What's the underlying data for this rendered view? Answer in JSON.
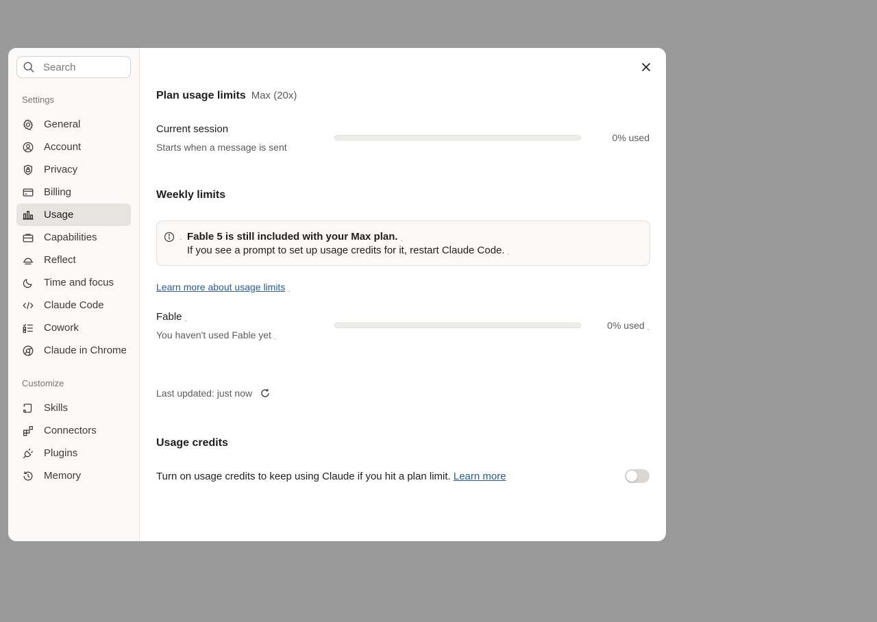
{
  "search": {
    "placeholder": "Search",
    "icon": "search-icon"
  },
  "sidebar": {
    "settings_label": "Settings",
    "settings_items": [
      {
        "label": "General",
        "icon": "gear-icon"
      },
      {
        "label": "Account",
        "icon": "user-circle-icon"
      },
      {
        "label": "Privacy",
        "icon": "shield-lock-icon"
      },
      {
        "label": "Billing",
        "icon": "credit-card-icon"
      },
      {
        "label": "Usage",
        "icon": "bar-chart-icon",
        "active": true
      },
      {
        "label": "Capabilities",
        "icon": "briefcase-icon"
      },
      {
        "label": "Reflect",
        "icon": "sunrise-icon"
      },
      {
        "label": "Time and focus",
        "icon": "moon-icon"
      },
      {
        "label": "Claude Code",
        "icon": "code-icon"
      },
      {
        "label": "Cowork",
        "icon": "checklist-icon"
      },
      {
        "label": "Claude in Chrome",
        "icon": "globe-icon"
      }
    ],
    "customize_label": "Customize",
    "customize_items": [
      {
        "label": "Skills",
        "icon": "scroll-icon"
      },
      {
        "label": "Connectors",
        "icon": "blocks-icon"
      },
      {
        "label": "Plugins",
        "icon": "plug-icon"
      },
      {
        "label": "Memory",
        "icon": "history-icon"
      }
    ]
  },
  "plan": {
    "title": "Plan usage limits",
    "plan_name": "Max (20x)",
    "session_label": "Current session",
    "session_sub": "Starts when a message is sent",
    "session_used_pct": 0,
    "session_used_text": "0% used"
  },
  "weekly": {
    "title": "Weekly limits",
    "notice_bold": "Fable 5 is still included with your Max plan.",
    "notice_text": "If you see a prompt to set up usage credits for it, restart Claude Code.",
    "learn_link": "Learn more about usage limits",
    "model_label": "Fable",
    "model_sub": "You haven't used Fable yet",
    "model_used_pct": 0,
    "model_used_text": "0% used"
  },
  "updated": {
    "text": "Last updated: just now"
  },
  "credits": {
    "title": "Usage credits",
    "desc": "Turn on usage credits to keep using Claude if you hit a plan limit.",
    "learn_more": "Learn more",
    "enabled": false
  },
  "colors": {
    "accent": "#3b6fd4",
    "link": "#2a5a9c",
    "active_bg": "#e6e4df"
  }
}
